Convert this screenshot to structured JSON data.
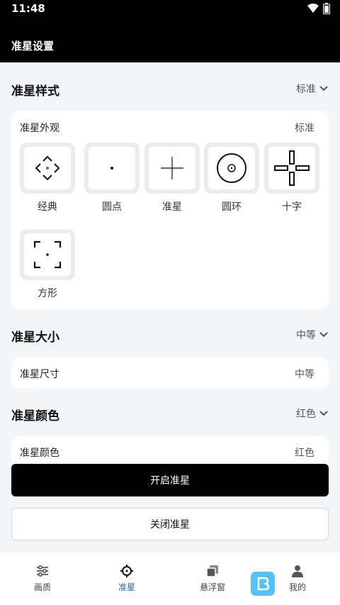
{
  "status": {
    "time": "11:48"
  },
  "header": {
    "title": "准星设置"
  },
  "sections": {
    "style": {
      "title": "准星样式",
      "value": "标准"
    },
    "size": {
      "title": "准星大小",
      "value": "中等"
    },
    "color": {
      "title": "准星颜色",
      "value": "红色"
    }
  },
  "style_card": {
    "label": "准星外观",
    "value": "标准",
    "items": [
      {
        "name": "经典",
        "icon": "classic-crosshair-icon"
      },
      {
        "name": "圆点",
        "icon": "dot-crosshair-icon"
      },
      {
        "name": "准星",
        "icon": "sight-crosshair-icon"
      },
      {
        "name": "圆环",
        "icon": "ring-crosshair-icon"
      },
      {
        "name": "十字",
        "icon": "cross-crosshair-icon"
      },
      {
        "name": "方形",
        "icon": "square-crosshair-icon"
      }
    ]
  },
  "size_card": {
    "label": "准星尺寸",
    "value": "中等"
  },
  "color_card": {
    "label": "准星颜色",
    "value": "红色"
  },
  "buttons": {
    "enable": "开启准星",
    "disable": "关闭准星"
  },
  "nav": [
    {
      "label": "画质",
      "icon": "sliders-icon"
    },
    {
      "label": "准星",
      "icon": "crosshair-icon"
    },
    {
      "label": "悬浮窗",
      "icon": "windows-icon"
    },
    {
      "label": "我的",
      "icon": "user-icon"
    }
  ],
  "colors": {
    "active": "#2b63c9",
    "accent_red": "#e53935",
    "watermark": "#2fb2f2"
  }
}
